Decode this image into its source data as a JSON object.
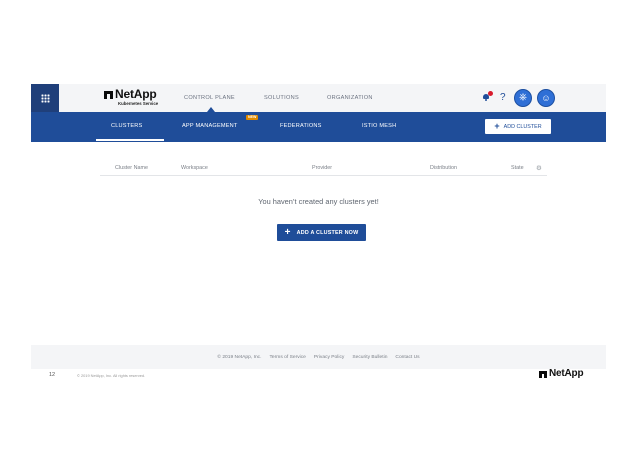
{
  "header": {
    "logo_text": "NetApp",
    "logo_sub": "Kubernetes Service",
    "nav": [
      "CONTROL PLANE",
      "SOLUTIONS",
      "ORGANIZATION"
    ],
    "help_label": "?"
  },
  "subnav": {
    "items": [
      "CLUSTERS",
      "APP MANAGEMENT",
      "FEDERATIONS",
      "ISTIO MESH"
    ],
    "new_badge": "NEW",
    "add_button": "ADD CLUSTER"
  },
  "table": {
    "columns": [
      "Cluster Name",
      "Workspace",
      "Provider",
      "Distribution",
      "State"
    ]
  },
  "empty_state": {
    "message": "You haven’t created any clusters yet!",
    "cta": "ADD A CLUSTER NOW"
  },
  "footer": {
    "links": [
      "© 2019 NetApp, Inc.",
      "Terms of Service",
      "Privacy Policy",
      "Security Bulletin",
      "Contact Us"
    ]
  },
  "slide": {
    "number": "12",
    "copyright": "© 2019 NetApp, Inc. All rights reserved.",
    "logo_text": "NetApp"
  },
  "colors": {
    "brand_blue": "#1f4d99",
    "badge_orange": "#e08a00",
    "alert_red": "#d81b2c"
  },
  "icons": [
    "grid-icon",
    "bell-icon",
    "help-icon",
    "kubernetes-icon",
    "avatar-icon",
    "plus-icon",
    "gear-icon",
    "netapp-logo-icon"
  ]
}
